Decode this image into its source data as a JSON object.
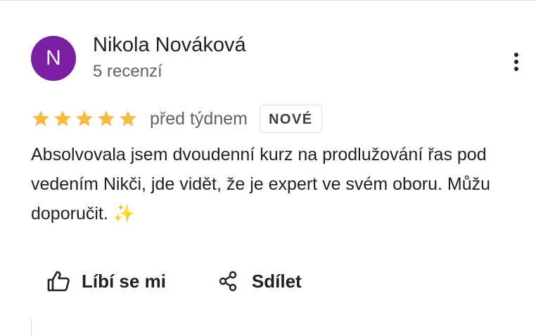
{
  "review": {
    "author": {
      "initial": "N",
      "name": "Nikola Nováková",
      "review_count": "5 recenzí",
      "avatar_color": "#7b1fa2"
    },
    "rating": 5,
    "rating_max": 5,
    "star_color": "#f6bb42",
    "date": "před týdnem",
    "badge": "NOVÉ",
    "text": "Absolvovala jsem dvoudenní kurz na prodlužování řas pod vedením Nikči, jde vidět, že je expert ve svém oboru. Můžu doporučit.",
    "text_emoji": "✨"
  },
  "actions": {
    "like_label": "Líbí se mi",
    "share_label": "Sdílet"
  },
  "icons": {
    "more": "more-vert-icon",
    "star": "star-icon",
    "like": "thumb-up-icon",
    "share": "share-icon"
  }
}
